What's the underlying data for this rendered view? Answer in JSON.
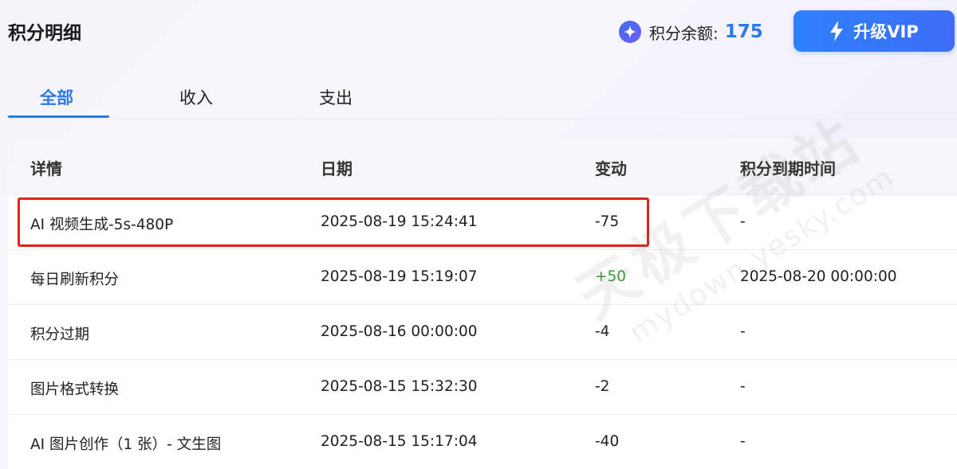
{
  "header": {
    "title": "积分明细",
    "balance_label": "积分余额:",
    "balance_value": "175",
    "upgrade_label": "升级VIP"
  },
  "tabs": [
    {
      "label": "全部",
      "active": true
    },
    {
      "label": "收入",
      "active": false
    },
    {
      "label": "支出",
      "active": false
    }
  ],
  "table": {
    "columns": [
      "详情",
      "日期",
      "变动",
      "积分到期时间"
    ],
    "rows": [
      {
        "detail": "AI 视频生成-5s-480P",
        "date": "2025-08-19 15:24:41",
        "change": "-75",
        "expiry": "-"
      },
      {
        "detail": "每日刷新积分",
        "date": "2025-08-19 15:19:07",
        "change": "+50",
        "expiry": "2025-08-20 00:00:00"
      },
      {
        "detail": "积分过期",
        "date": "2025-08-16 00:00:00",
        "change": "-4",
        "expiry": "-"
      },
      {
        "detail": "图片格式转换",
        "date": "2025-08-15 15:32:30",
        "change": "-2",
        "expiry": "-"
      },
      {
        "detail": "AI 图片创作（1 张）- 文生图",
        "date": "2025-08-15 15:17:04",
        "change": "-40",
        "expiry": "-"
      }
    ]
  },
  "watermark": {
    "text": "天极下载站",
    "url": "mydown.yesky.com"
  },
  "colors": {
    "accent": "#2a79f0",
    "positive": "#3a9a36",
    "highlight": "#e3201b"
  },
  "icons": {
    "balance": "sparkle-icon",
    "upgrade": "lightning-icon"
  }
}
